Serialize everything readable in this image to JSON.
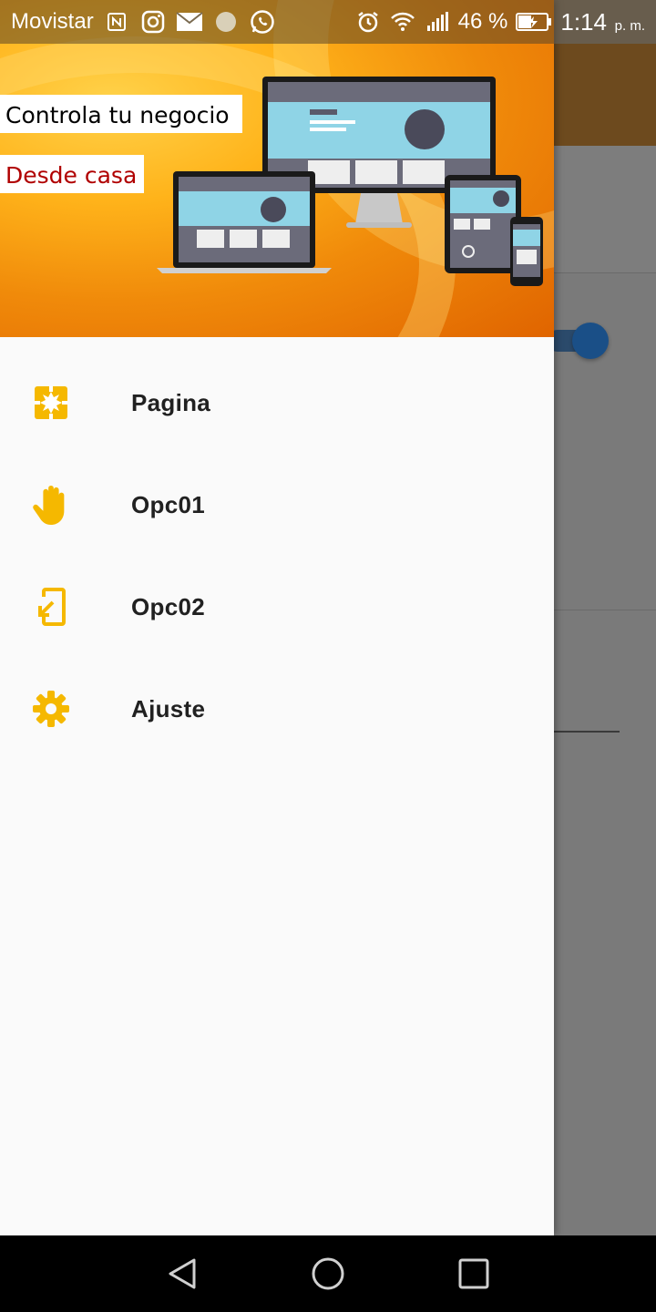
{
  "status_bar": {
    "carrier": "Movistar",
    "battery": "46 %",
    "time": "1:14",
    "time_suffix": "p. m."
  },
  "drawer": {
    "header": {
      "line1": "Controla  tu negocio",
      "line2": "Desde casa"
    },
    "items": [
      {
        "label": "Pagina",
        "icon": "puzzle-icon"
      },
      {
        "label": "Opc01",
        "icon": "hand-icon"
      },
      {
        "label": "Opc02",
        "icon": "phone-arrow-icon"
      },
      {
        "label": "Ajuste",
        "icon": "gear-icon"
      }
    ]
  },
  "colors": {
    "accent": "#f5b800",
    "header_orange": "#f08a0a",
    "toggle_blue": "#1a4f87",
    "red_text": "#b00000"
  }
}
